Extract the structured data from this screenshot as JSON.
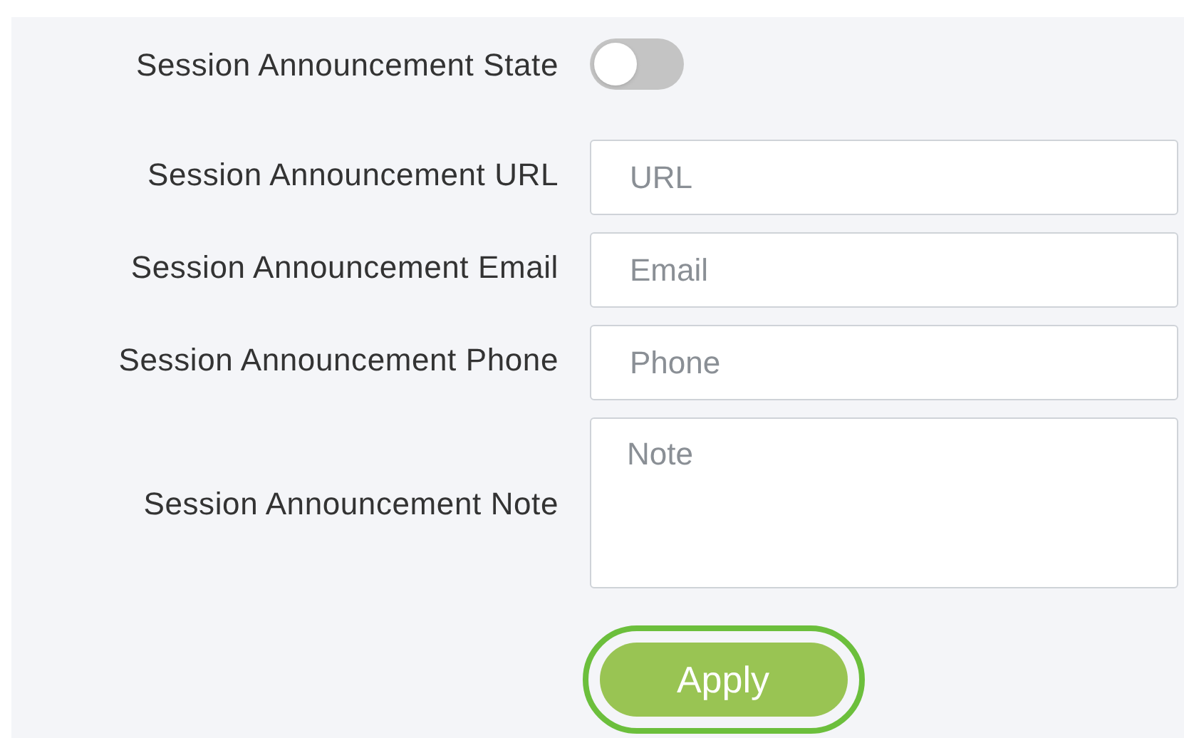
{
  "state": {
    "label": "Session Announcement State",
    "on": false
  },
  "fields": [
    {
      "kind": "input",
      "label": "Session Announcement URL",
      "placeholder": "URL"
    },
    {
      "kind": "input",
      "label": "Session Announcement Email",
      "placeholder": "Email"
    },
    {
      "kind": "input",
      "label": "Session Announcement Phone",
      "placeholder": "Phone"
    },
    {
      "kind": "textarea",
      "label": "Session Announcement Note",
      "placeholder": "Note"
    }
  ],
  "apply_button": {
    "label": "Apply",
    "highlighted": true
  }
}
